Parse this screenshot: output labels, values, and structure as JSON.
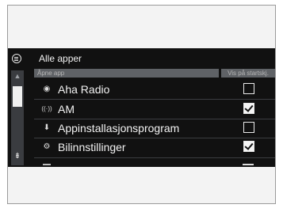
{
  "header": {
    "title": "Alle apper"
  },
  "columns": {
    "app": "Åpne app",
    "show": "Vis på startskj."
  },
  "rows": [
    {
      "label": "Aha Radio",
      "icon": "aha-icon",
      "glyph": "◉",
      "checked": false
    },
    {
      "label": "AM",
      "icon": "am-radio-icon",
      "glyph": "((·))",
      "checked": true
    },
    {
      "label": "Appinstallasjonsprogram",
      "icon": "app-installer-icon",
      "glyph": "⬇",
      "checked": false
    },
    {
      "label": "Bilinnstillinger",
      "icon": "car-settings-icon",
      "glyph": "⚙",
      "checked": true
    }
  ]
}
